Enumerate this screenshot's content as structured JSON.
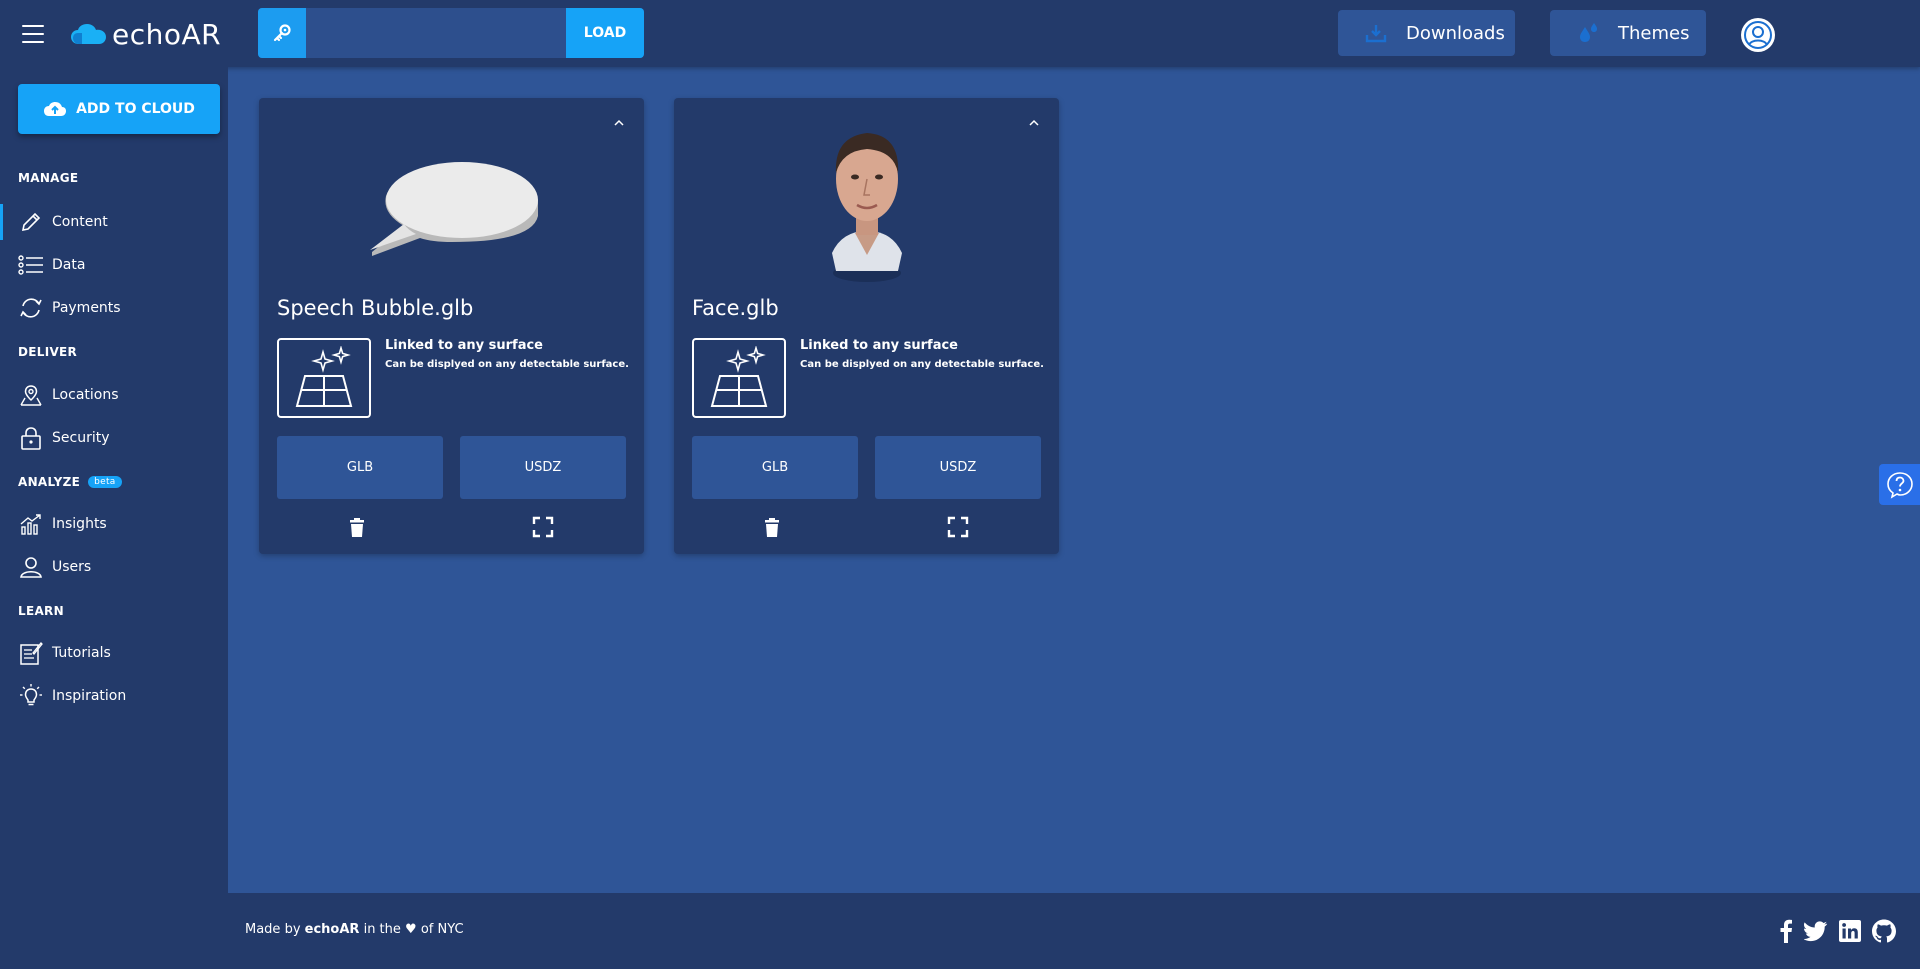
{
  "header": {
    "logo_text": "echoAR",
    "api_key": {
      "value": "",
      "placeholder": ""
    },
    "load_label": "LOAD",
    "downloads_label": "Downloads",
    "themes_label": "Themes"
  },
  "sidebar": {
    "add_to_cloud_label": "ADD TO CLOUD",
    "sections": {
      "manage": "MANAGE",
      "deliver": "DELIVER",
      "analyze": "ANALYZE",
      "analyze_badge": "beta",
      "learn": "LEARN"
    },
    "items": {
      "content": "Content",
      "data": "Data",
      "payments": "Payments",
      "locations": "Locations",
      "security": "Security",
      "insights": "Insights",
      "users": "Users",
      "tutorials": "Tutorials",
      "inspiration": "Inspiration"
    },
    "active_item": "Content"
  },
  "cards": [
    {
      "title": "Speech Bubble.glb",
      "link_title": "Linked to any surface",
      "link_desc": "Can be displyed on any detectable surface.",
      "glb_label": "GLB",
      "usdz_label": "USDZ"
    },
    {
      "title": "Face.glb",
      "link_title": "Linked to any surface",
      "link_desc": "Can be displyed on any detectable surface.",
      "glb_label": "GLB",
      "usdz_label": "USDZ"
    }
  ],
  "footer": {
    "prefix": "Made by",
    "brand": "echoAR",
    "middle": "in the",
    "heart": "♥",
    "suffix": "of NYC"
  },
  "icons": {
    "menu": "hamburger-icon",
    "key": "key-icon",
    "downloads": "download-icon",
    "themes": "paint-drop-icon",
    "avatar": "user-avatar-icon",
    "help": "help-icon",
    "social": [
      "facebook-icon",
      "twitter-icon",
      "linkedin-icon",
      "github-icon"
    ]
  },
  "colors": {
    "background": "#2f5597",
    "panel": "#233a6a",
    "accent": "#16a3f7",
    "help_tab": "#2a6fe8"
  }
}
